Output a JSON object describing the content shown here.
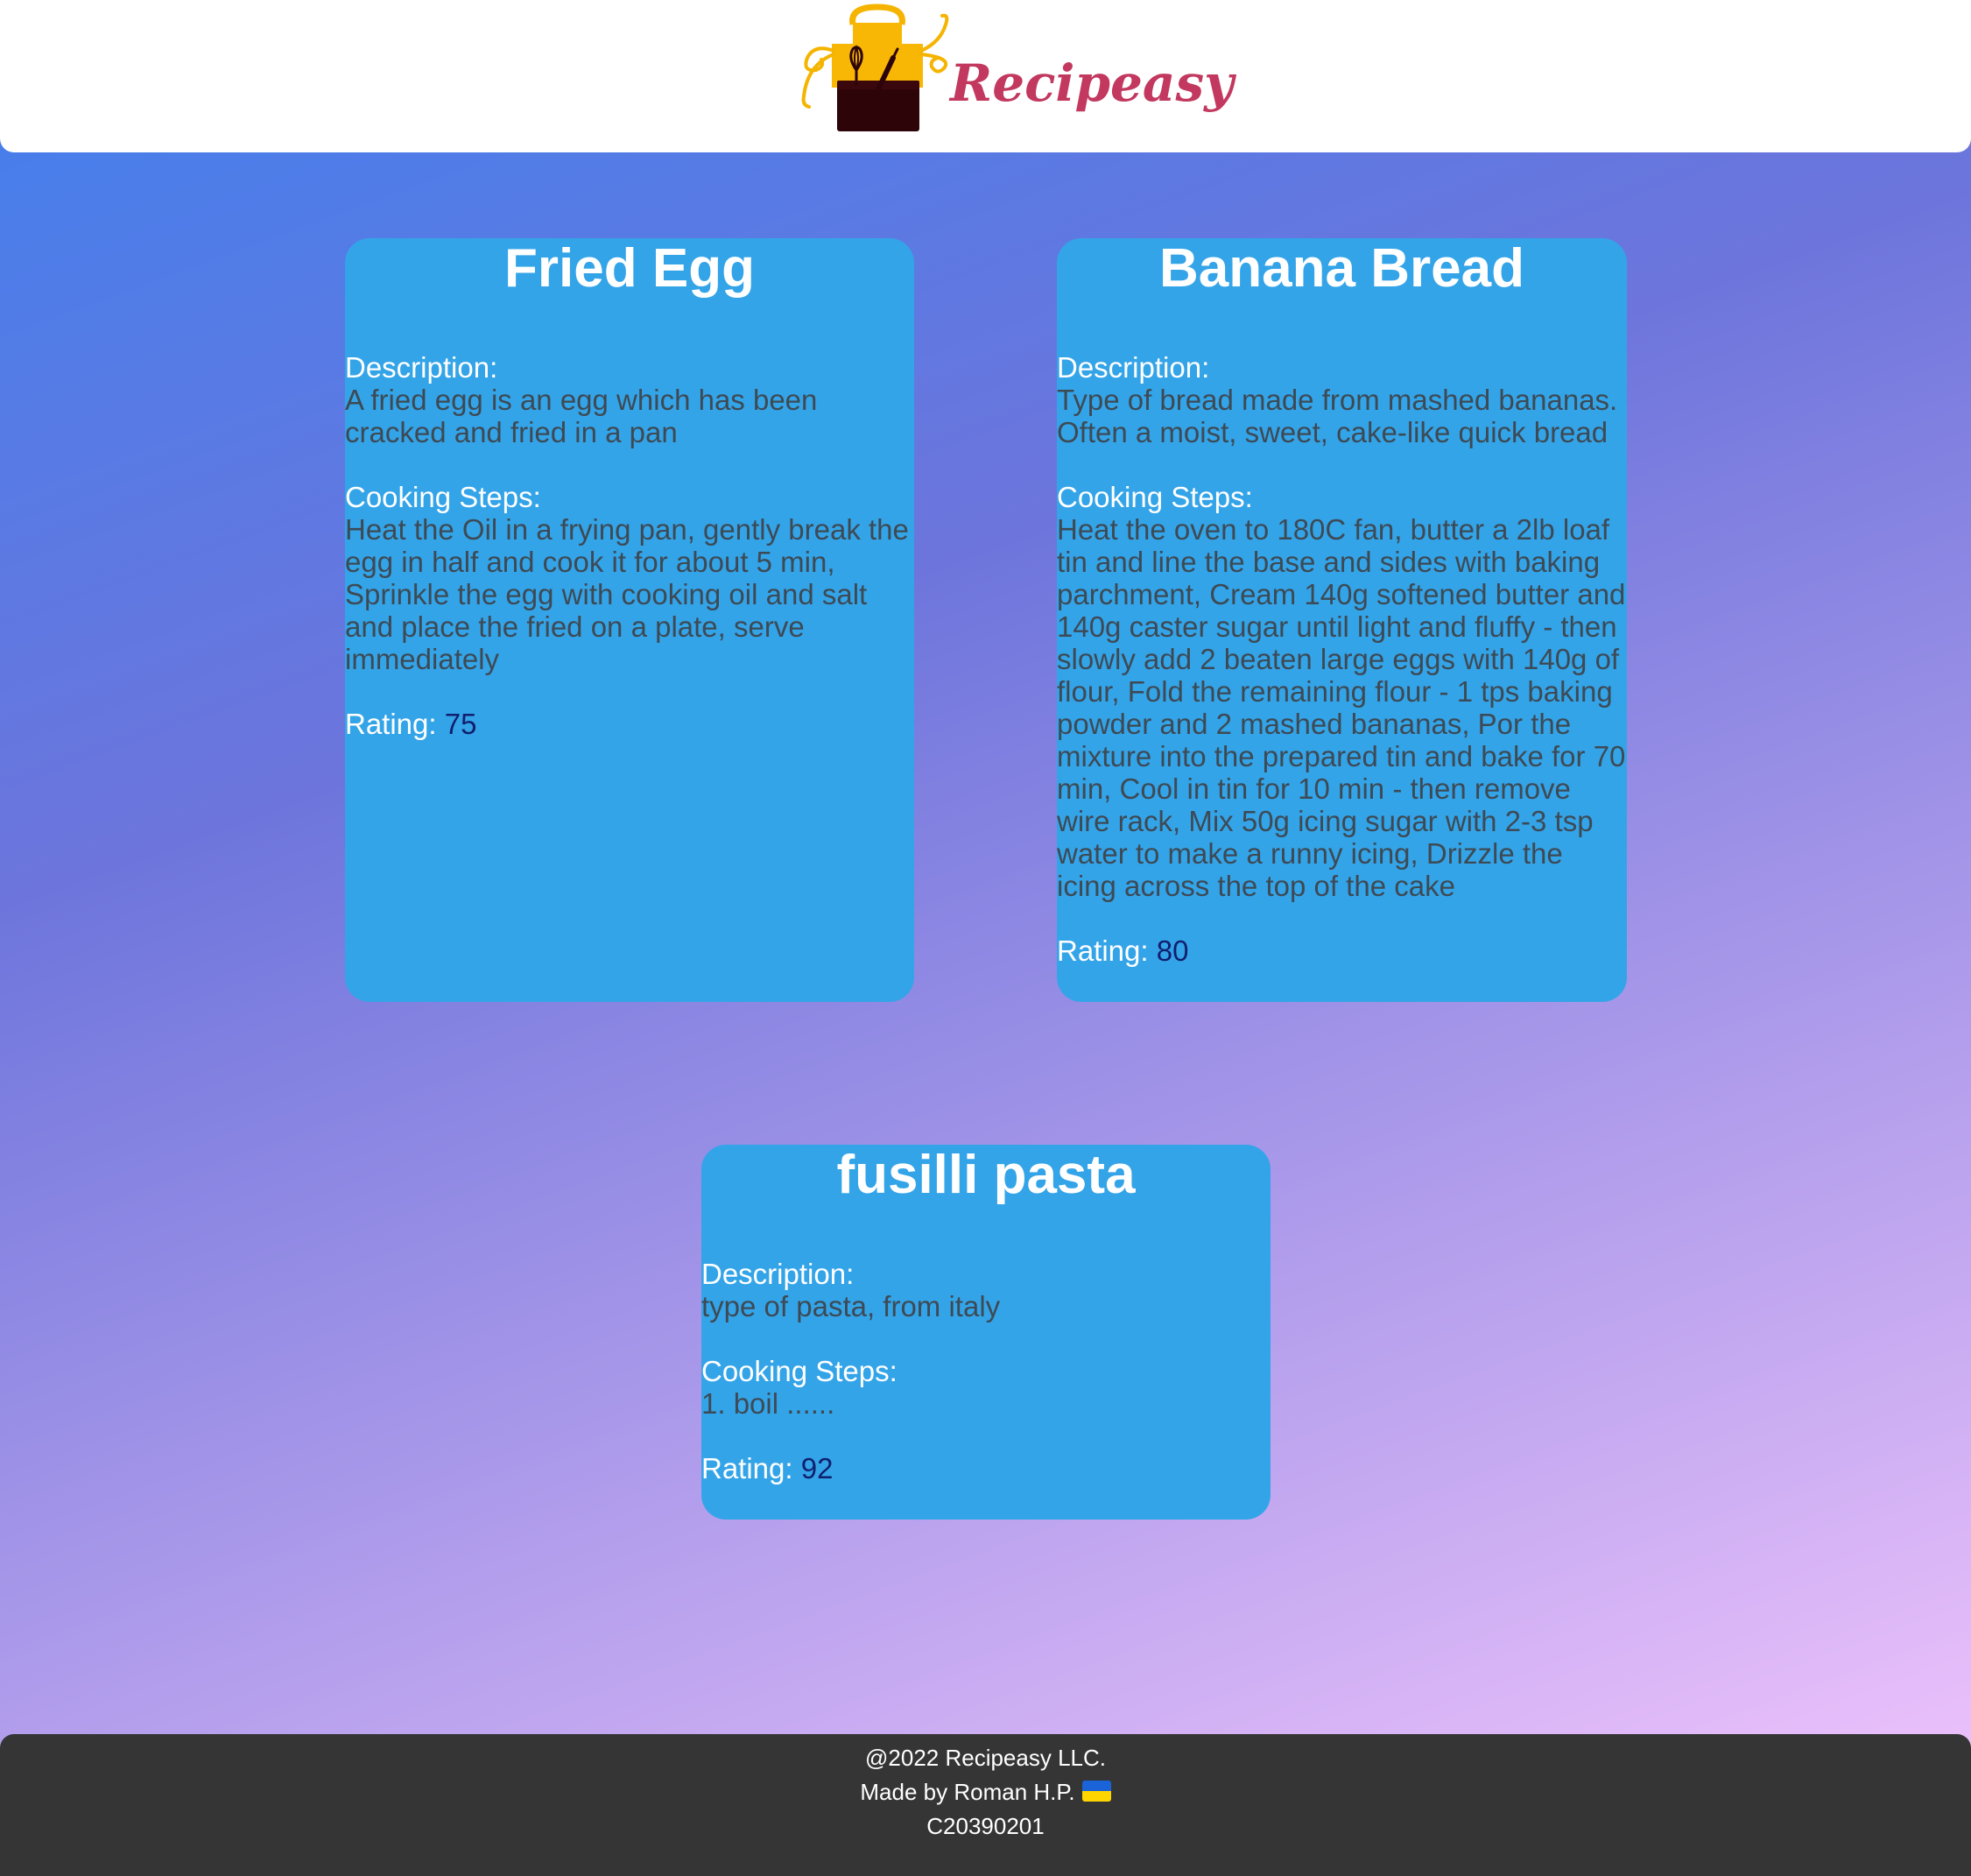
{
  "header": {
    "logo_text": "Recipeasy",
    "logo_icon": "apron-icon"
  },
  "recipes": [
    {
      "title": "Fried Egg",
      "description_label": "Description:",
      "description": "A fried egg is an egg which has been cracked and fried in a pan",
      "steps_label": "Cooking Steps:",
      "steps": "Heat the Oil in a frying pan, gently break the egg in half and cook it for about 5 min, Sprinkle the egg with cooking oil and salt and place the fried on a plate, serve immediately",
      "rating_label": "Rating:",
      "rating": "75"
    },
    {
      "title": "Banana Bread",
      "description_label": "Description:",
      "description": "Type of bread made from mashed bananas. Often a moist, sweet, cake-like quick bread",
      "steps_label": "Cooking Steps:",
      "steps": "Heat the oven to 180C fan, butter a 2lb loaf tin and line the base and sides with baking parchment, Cream 140g softened butter and 140g caster sugar until light and fluffy - then slowly add 2 beaten large eggs with 140g of flour, Fold the remaining flour - 1 tps baking powder and 2 mashed bananas, Por the mixture into the prepared tin and bake for 70 min, Cool in tin for 10 min - then remove wire rack, Mix 50g icing sugar with 2-3 tsp water to make a runny icing, Drizzle the icing across the top of the cake",
      "rating_label": "Rating:",
      "rating": "80"
    },
    {
      "title": "fusilli pasta",
      "description_label": "Description:",
      "description": "type of pasta, from italy",
      "steps_label": "Cooking Steps:",
      "steps": "1. boil ......",
      "rating_label": "Rating:",
      "rating": "92"
    }
  ],
  "footer": {
    "copyright": "@2022 Recipeasy LLC.",
    "made_by": "Made by Roman H.P.",
    "flag_icon": "ukraine-flag-icon",
    "code": "C20390201"
  },
  "colors": {
    "card": "#34a4e8",
    "logo_text": "#c2385f",
    "footer": "#353535",
    "rating_value": "#10206e",
    "body_text": "#3d4a55"
  }
}
